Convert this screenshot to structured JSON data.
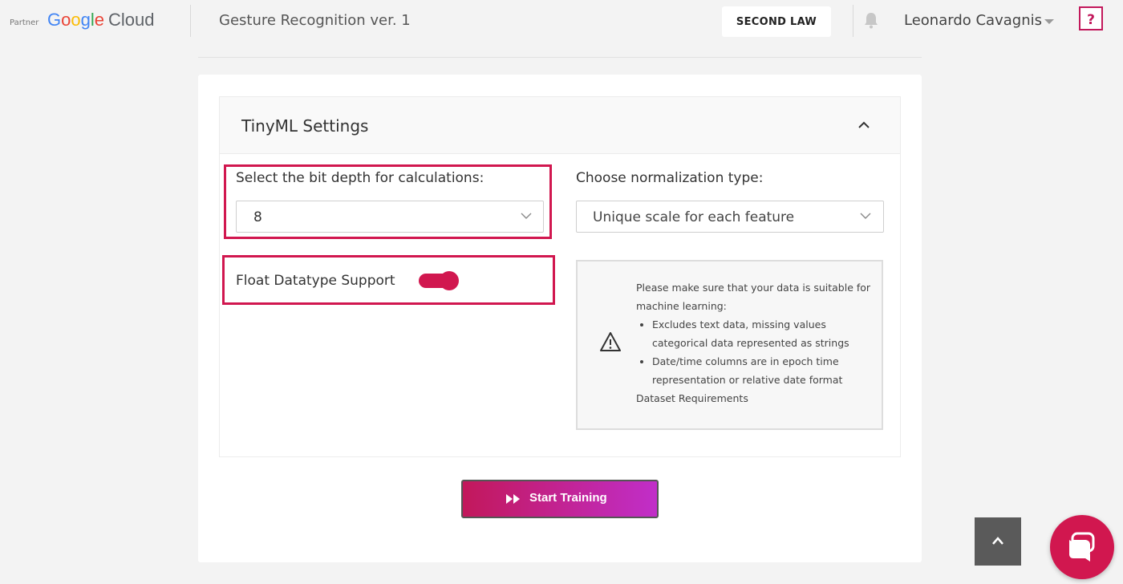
{
  "header": {
    "partner_label": "Partner",
    "logo": {
      "google": [
        "G",
        "o",
        "o",
        "g",
        "l",
        "e"
      ],
      "cloud": "Cloud"
    },
    "project_title": "Gesture Recognition ver. 1",
    "org_button": "SECOND LAW",
    "bell_icon": "bell-icon",
    "user_name": "Leonardo Cavagnis",
    "help_label": "?"
  },
  "settings": {
    "title": "TinyML Settings",
    "bit_depth": {
      "label": "Select the bit depth for calculations:",
      "value": "8"
    },
    "float_support": {
      "label": "Float Datatype Support",
      "enabled": true
    },
    "normalization": {
      "label": "Choose normalization type:",
      "value": "Unique scale for each feature"
    },
    "notice": {
      "intro": "Please make sure that your data is suitable for machine learning:",
      "items": [
        "Excludes text data, missing values categorical data represented as strings",
        "Date/time columns are in epoch time representation or relative date format"
      ],
      "link": "Dataset Requirements"
    }
  },
  "actions": {
    "start_training": "Start Training"
  },
  "colors": {
    "accent": "#d1174f",
    "gradient_start": "#c2185b",
    "gradient_end": "#c12ec9"
  }
}
